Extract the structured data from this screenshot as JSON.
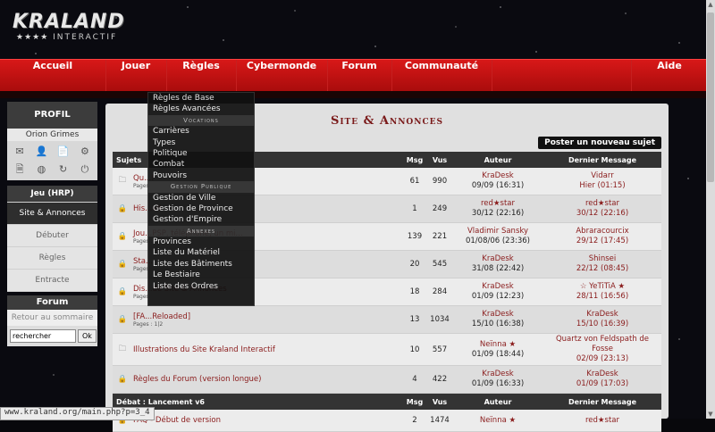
{
  "logo": {
    "title": "KRALAND",
    "stars": "★★★★",
    "sub": "INTERACTIF"
  },
  "nav": {
    "items": [
      "Accueil",
      "Jouer",
      "Règles",
      "Cybermonde",
      "Forum",
      "Communauté",
      "Aide"
    ]
  },
  "sidebar": {
    "profil_title": "PROFIL",
    "player_name": "Orion Grimes",
    "icons": [
      "mail-icon",
      "person-icon",
      "document-icon",
      "gear-icon",
      "page-icon",
      "globe-icon",
      "refresh-icon",
      "power-icon"
    ],
    "icon_glyphs": [
      "✉",
      "👤",
      "📄",
      "⚙",
      "🗎",
      "◍",
      "↻",
      "⏻"
    ],
    "jeu_title": "Jeu (HRP)",
    "jeu_items": [
      "Site & Annonces",
      "Débuter",
      "Règles",
      "Entracte"
    ],
    "forum_title": "Forum",
    "back_link": "Retour au sommaire",
    "search_value": "rechercher",
    "search_button": "Ok"
  },
  "main": {
    "title": "Site & Annonces",
    "new_post": "Poster un nouveau sujet",
    "headers": {
      "subjects": "Sujets",
      "msg": "Msg",
      "vus": "Vus",
      "auteur": "Auteur",
      "dernier": "Dernier Message"
    },
    "topics": [
      {
        "subject": "Qu...!",
        "pages": "Pages",
        "msg": "61",
        "vus": "990",
        "author": "KraDesk",
        "author_date": "09/09 (16:31)",
        "last": "Vidarr",
        "last_date": "Hier (01:15)"
      },
      {
        "subject": "His...v6",
        "pages": "",
        "msg": "1",
        "vus": "249",
        "author": "red★star",
        "author_date": "30/12 (22:16)",
        "last": "red★star",
        "last_date": "30/12 (22:16)"
      },
      {
        "subject": "Jou...PSP, téléphone, un mi...",
        "pages": "Pages ... 13|14",
        "msg": "139",
        "vus": "221",
        "author": "Vladimir Sansky",
        "author_date": "01/08/06 (23:36)",
        "last": "Abraracourcix",
        "last_date": "29/12 (17:45)"
      },
      {
        "subject": "Sta...",
        "pages": "Pages",
        "msg": "20",
        "vus": "545",
        "author": "KraDesk",
        "author_date": "31/08 (22:42)",
        "last": "Shinsei",
        "last_date": "22/12 (08:45)"
      },
      {
        "subject": "Dis...de Site & Annonces",
        "pages": "Pages",
        "msg": "18",
        "vus": "284",
        "author": "KraDesk",
        "author_date": "01/09 (12:23)",
        "last": "☆ YeTiTiA ★",
        "last_date": "28/11 (16:56)"
      },
      {
        "subject": "[FA...Reloaded]",
        "pages": "Pages : 1|2",
        "msg": "13",
        "vus": "1034",
        "author": "KraDesk",
        "author_date": "15/10 (16:38)",
        "last": "KraDesk",
        "last_date": "15/10 (16:39)"
      },
      {
        "subject": "Illustrations du Site Kraland Interactif",
        "pages": "",
        "msg": "10",
        "vus": "557",
        "author": "Neïnna ★",
        "author_date": "01/09 (18:44)",
        "last": "Quartz von Feldspath de Fosse",
        "last_date": "02/09 (23:13)"
      },
      {
        "subject": "Règles du Forum (version longue)",
        "pages": "",
        "msg": "4",
        "vus": "422",
        "author": "KraDesk",
        "author_date": "01/09 (16:33)",
        "last": "KraDesk",
        "last_date": "01/09 (17:03)"
      }
    ],
    "category": "Débat : Lancement v6",
    "cat_topic": {
      "subject": "FAQ - Début de version",
      "msg": "2",
      "vus": "1474",
      "author": "Neïnna ★",
      "last": "red★star"
    }
  },
  "dropdown": [
    {
      "type": "item",
      "label": "Règles de Base"
    },
    {
      "type": "item",
      "label": "Règles Avancées"
    },
    {
      "type": "section",
      "label": "Vocations"
    },
    {
      "type": "item",
      "label": "Carrières"
    },
    {
      "type": "item",
      "label": "Types"
    },
    {
      "type": "item",
      "label": "Politique"
    },
    {
      "type": "item",
      "label": "Combat"
    },
    {
      "type": "item",
      "label": "Pouvoirs"
    },
    {
      "type": "section",
      "label": "Gestion Publique"
    },
    {
      "type": "item",
      "label": "Gestion de Ville"
    },
    {
      "type": "item",
      "label": "Gestion de Province"
    },
    {
      "type": "item",
      "label": "Gestion d'Empire"
    },
    {
      "type": "section",
      "label": "Annexes"
    },
    {
      "type": "item",
      "label": "Provinces"
    },
    {
      "type": "item",
      "label": "Liste du Matériel"
    },
    {
      "type": "item",
      "label": "Liste des Bâtiments"
    },
    {
      "type": "item",
      "label": "Le Bestiaire"
    },
    {
      "type": "item",
      "label": "Liste des Ordres"
    }
  ],
  "status_url": "www.kraland.org/main.php?p=3_4"
}
